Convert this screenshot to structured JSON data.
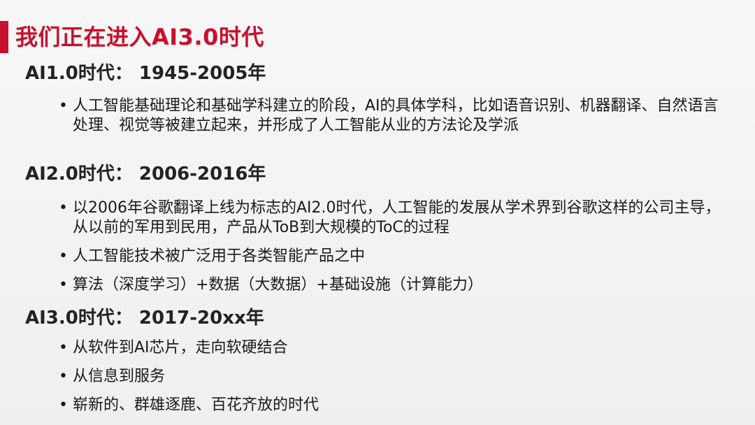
{
  "title": "我们正在进入AI3.0时代",
  "sections": [
    {
      "heading": "AI1.0时代：  1945-2005年",
      "bullets": [
        "人工智能基础理论和基础学科建立的阶段，AI的具体学科，比如语音识别、机器翻译、自然语言处理、视觉等被建立起来，并形成了人工智能从业的方法论及学派"
      ]
    },
    {
      "heading": "AI2.0时代：  2006-2016年",
      "bullets": [
        "以2006年谷歌翻译上线为标志的AI2.0时代，人工智能的发展从学术界到谷歌这样的公司主导，从以前的军用到民用，产品从ToB到大规模的ToC的过程",
        "人工智能技术被广泛用于各类智能产品之中",
        "算法（深度学习）+数据（大数据）+基础设施（计算能力）"
      ]
    },
    {
      "heading": "AI3.0时代：  2017-20xx年",
      "bullets": [
        "从软件到AI芯片，走向软硬结合",
        "从信息到服务",
        "崭新的、群雄逐鹿、百花齐放的时代"
      ]
    }
  ],
  "colors": {
    "accent": "#c8102e",
    "text": "#1a1a1a"
  }
}
